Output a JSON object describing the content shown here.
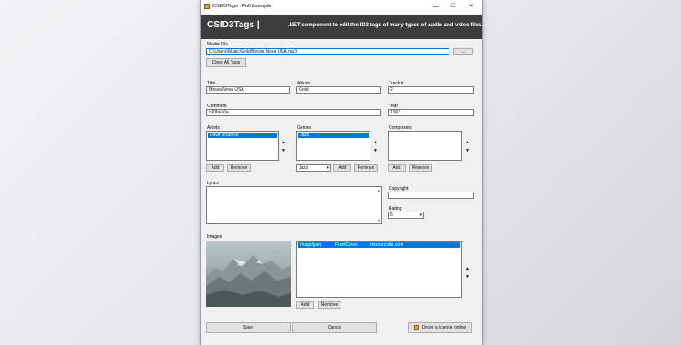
{
  "window": {
    "title": "CSID3Tags - Full Example",
    "controls": {
      "minimize": "—",
      "maximize": "☐",
      "close": "✕"
    }
  },
  "banner": {
    "logo": "CSID3Tags |",
    "tagline": ".NET component to edit the ID3 tags of many types of audio and video files."
  },
  "media_file": {
    "label": "Media File",
    "value": "C:\\Users\\Music\\Gold\\Bossa Nova USA.mp3",
    "browse_label": "...",
    "clear_label": "Clear All Tags"
  },
  "fields": {
    "title_label": "Title",
    "title_value": "Bossa Nova USA",
    "album_label": "Album",
    "album_value": "Gold",
    "track_label": "Track #",
    "track_value": "2",
    "comment_label": "Comment",
    "comment_value": "c40be50e",
    "year_label": "Year",
    "year_value": "1963"
  },
  "artists": {
    "label": "Artists",
    "items": [
      "Dave Brubeck"
    ],
    "add_label": "Add",
    "remove_label": "Remove"
  },
  "genres": {
    "label": "Genres",
    "items": [
      "Jazz"
    ],
    "combo_value": "Jazz",
    "add_label": "Add",
    "remove_label": "Remove"
  },
  "composers": {
    "label": "Composers",
    "add_label": "Add",
    "remove_label": "Remove"
  },
  "arrows": {
    "up": "▲",
    "down": "▼"
  },
  "lyrics": {
    "label": "Lyrics",
    "value": ""
  },
  "copyright": {
    "label": "Copyright",
    "value": ""
  },
  "rating": {
    "label": "Rating",
    "value": "5"
  },
  "images": {
    "label": "Images",
    "row": {
      "mime": "image/jpeg",
      "type": "FrontCover",
      "description": "mixvorcode.com"
    },
    "add_label": "Add",
    "remove_label": "Remove"
  },
  "footer": {
    "save_label": "Save",
    "cancel_label": "Cancel",
    "order_label": "Order a license online"
  },
  "colors": {
    "banner_bg": "#3c3c3c",
    "selection": "#0078d7",
    "window_bg": "#f0f0f0"
  }
}
